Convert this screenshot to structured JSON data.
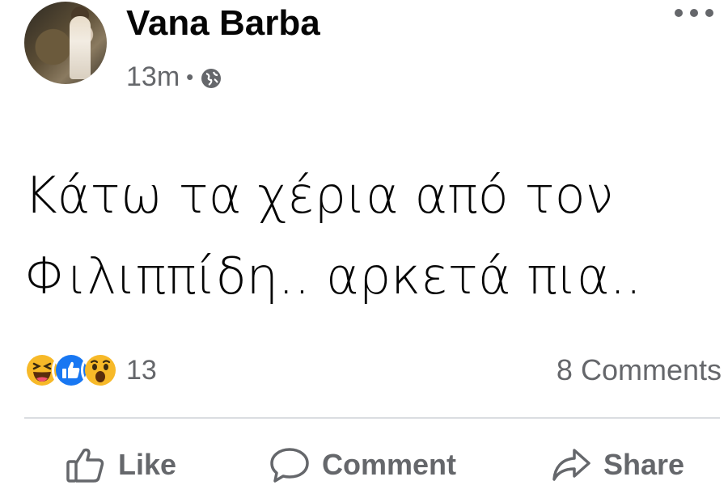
{
  "post": {
    "author": "Vana Barba",
    "time": "13m",
    "separator": "•",
    "privacy_icon": "globe-icon",
    "more_icon": "more-options-icon",
    "text": "Κάτω τα χέρια από τον\nΦιλιππίδη.. αρκετά πια.."
  },
  "reactions": {
    "icons": [
      "haha-icon",
      "like-icon",
      "wow-icon"
    ],
    "count": "13",
    "comments": "8 Comments"
  },
  "actions": {
    "like": "Like",
    "comment": "Comment",
    "share": "Share"
  },
  "colors": {
    "secondary_text": "#65676b",
    "primary_text": "#050505",
    "like_blue": "#1877f2",
    "reaction_yellow": "#f7b928",
    "divider": "#dadde1"
  }
}
